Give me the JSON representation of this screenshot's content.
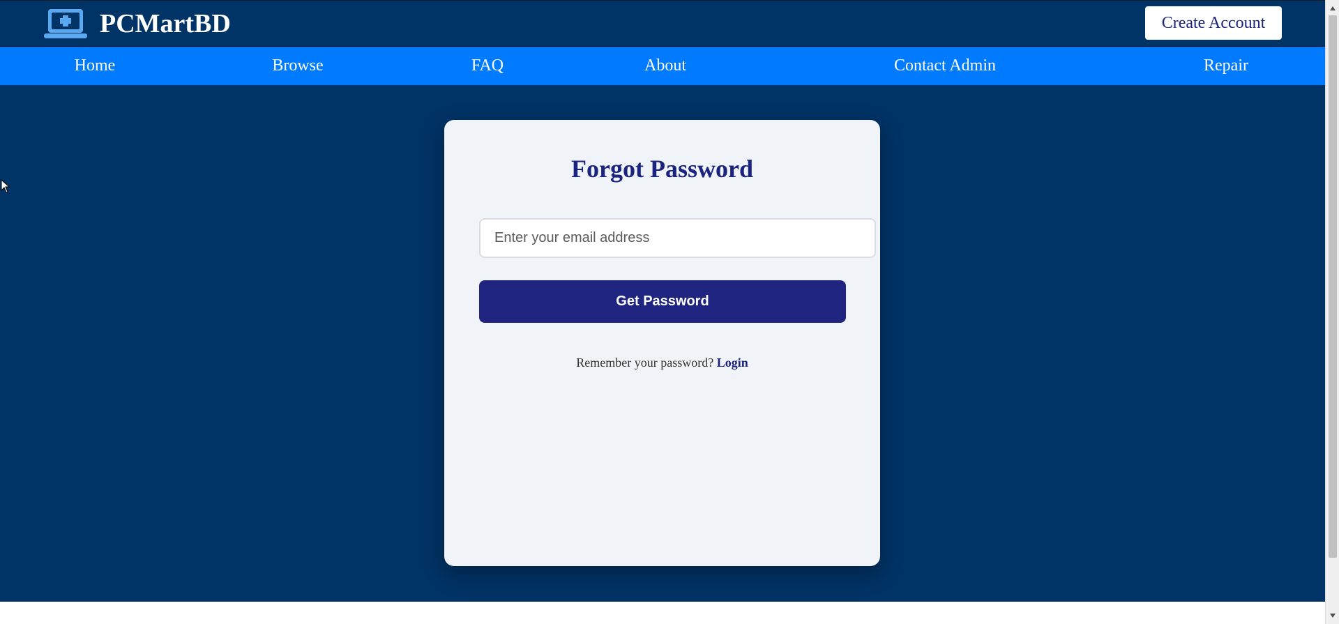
{
  "header": {
    "brand_name": "PCMartBD",
    "brand_icon": "laptop-plus-icon",
    "create_account_label": "Create Account"
  },
  "nav": {
    "items": [
      {
        "label": "Home"
      },
      {
        "label": "Browse"
      },
      {
        "label": "FAQ"
      },
      {
        "label": "About"
      },
      {
        "label": "Contact Admin"
      },
      {
        "label": "Repair"
      }
    ]
  },
  "form": {
    "title": "Forgot Password",
    "email_placeholder": "Enter your email address",
    "email_value": "",
    "submit_label": "Get Password",
    "remember_text": "Remember your password?",
    "login_label": "Login"
  },
  "colors": {
    "header_bg": "#003366",
    "nav_bg": "#007bff",
    "card_bg": "#f0f4f8",
    "title_color": "#1a237e",
    "button_bg": "#1e2480"
  }
}
